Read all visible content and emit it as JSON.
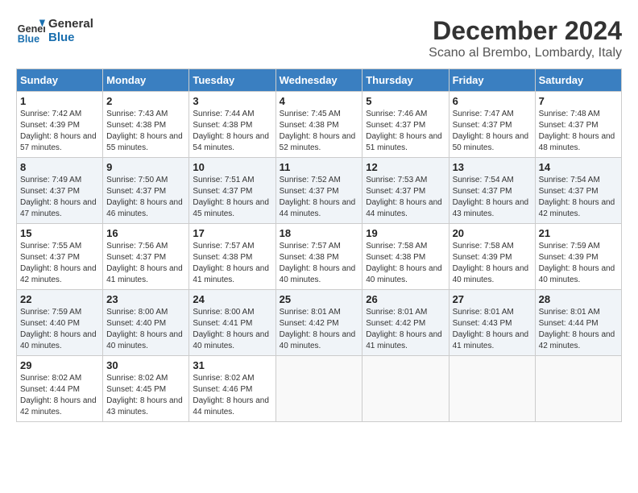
{
  "header": {
    "logo_line1": "General",
    "logo_line2": "Blue",
    "month": "December 2024",
    "location": "Scano al Brembo, Lombardy, Italy"
  },
  "weekdays": [
    "Sunday",
    "Monday",
    "Tuesday",
    "Wednesday",
    "Thursday",
    "Friday",
    "Saturday"
  ],
  "weeks": [
    [
      {
        "day": "1",
        "sunrise": "7:42 AM",
        "sunset": "4:39 PM",
        "daylight": "8 hours and 57 minutes."
      },
      {
        "day": "2",
        "sunrise": "7:43 AM",
        "sunset": "4:38 PM",
        "daylight": "8 hours and 55 minutes."
      },
      {
        "day": "3",
        "sunrise": "7:44 AM",
        "sunset": "4:38 PM",
        "daylight": "8 hours and 54 minutes."
      },
      {
        "day": "4",
        "sunrise": "7:45 AM",
        "sunset": "4:38 PM",
        "daylight": "8 hours and 52 minutes."
      },
      {
        "day": "5",
        "sunrise": "7:46 AM",
        "sunset": "4:37 PM",
        "daylight": "8 hours and 51 minutes."
      },
      {
        "day": "6",
        "sunrise": "7:47 AM",
        "sunset": "4:37 PM",
        "daylight": "8 hours and 50 minutes."
      },
      {
        "day": "7",
        "sunrise": "7:48 AM",
        "sunset": "4:37 PM",
        "daylight": "8 hours and 48 minutes."
      }
    ],
    [
      {
        "day": "8",
        "sunrise": "7:49 AM",
        "sunset": "4:37 PM",
        "daylight": "8 hours and 47 minutes."
      },
      {
        "day": "9",
        "sunrise": "7:50 AM",
        "sunset": "4:37 PM",
        "daylight": "8 hours and 46 minutes."
      },
      {
        "day": "10",
        "sunrise": "7:51 AM",
        "sunset": "4:37 PM",
        "daylight": "8 hours and 45 minutes."
      },
      {
        "day": "11",
        "sunrise": "7:52 AM",
        "sunset": "4:37 PM",
        "daylight": "8 hours and 44 minutes."
      },
      {
        "day": "12",
        "sunrise": "7:53 AM",
        "sunset": "4:37 PM",
        "daylight": "8 hours and 44 minutes."
      },
      {
        "day": "13",
        "sunrise": "7:54 AM",
        "sunset": "4:37 PM",
        "daylight": "8 hours and 43 minutes."
      },
      {
        "day": "14",
        "sunrise": "7:54 AM",
        "sunset": "4:37 PM",
        "daylight": "8 hours and 42 minutes."
      }
    ],
    [
      {
        "day": "15",
        "sunrise": "7:55 AM",
        "sunset": "4:37 PM",
        "daylight": "8 hours and 42 minutes."
      },
      {
        "day": "16",
        "sunrise": "7:56 AM",
        "sunset": "4:37 PM",
        "daylight": "8 hours and 41 minutes."
      },
      {
        "day": "17",
        "sunrise": "7:57 AM",
        "sunset": "4:38 PM",
        "daylight": "8 hours and 41 minutes."
      },
      {
        "day": "18",
        "sunrise": "7:57 AM",
        "sunset": "4:38 PM",
        "daylight": "8 hours and 40 minutes."
      },
      {
        "day": "19",
        "sunrise": "7:58 AM",
        "sunset": "4:38 PM",
        "daylight": "8 hours and 40 minutes."
      },
      {
        "day": "20",
        "sunrise": "7:58 AM",
        "sunset": "4:39 PM",
        "daylight": "8 hours and 40 minutes."
      },
      {
        "day": "21",
        "sunrise": "7:59 AM",
        "sunset": "4:39 PM",
        "daylight": "8 hours and 40 minutes."
      }
    ],
    [
      {
        "day": "22",
        "sunrise": "7:59 AM",
        "sunset": "4:40 PM",
        "daylight": "8 hours and 40 minutes."
      },
      {
        "day": "23",
        "sunrise": "8:00 AM",
        "sunset": "4:40 PM",
        "daylight": "8 hours and 40 minutes."
      },
      {
        "day": "24",
        "sunrise": "8:00 AM",
        "sunset": "4:41 PM",
        "daylight": "8 hours and 40 minutes."
      },
      {
        "day": "25",
        "sunrise": "8:01 AM",
        "sunset": "4:42 PM",
        "daylight": "8 hours and 40 minutes."
      },
      {
        "day": "26",
        "sunrise": "8:01 AM",
        "sunset": "4:42 PM",
        "daylight": "8 hours and 41 minutes."
      },
      {
        "day": "27",
        "sunrise": "8:01 AM",
        "sunset": "4:43 PM",
        "daylight": "8 hours and 41 minutes."
      },
      {
        "day": "28",
        "sunrise": "8:01 AM",
        "sunset": "4:44 PM",
        "daylight": "8 hours and 42 minutes."
      }
    ],
    [
      {
        "day": "29",
        "sunrise": "8:02 AM",
        "sunset": "4:44 PM",
        "daylight": "8 hours and 42 minutes."
      },
      {
        "day": "30",
        "sunrise": "8:02 AM",
        "sunset": "4:45 PM",
        "daylight": "8 hours and 43 minutes."
      },
      {
        "day": "31",
        "sunrise": "8:02 AM",
        "sunset": "4:46 PM",
        "daylight": "8 hours and 44 minutes."
      },
      null,
      null,
      null,
      null
    ]
  ],
  "labels": {
    "sunrise": "Sunrise: ",
    "sunset": "Sunset: ",
    "daylight": "Daylight: "
  }
}
